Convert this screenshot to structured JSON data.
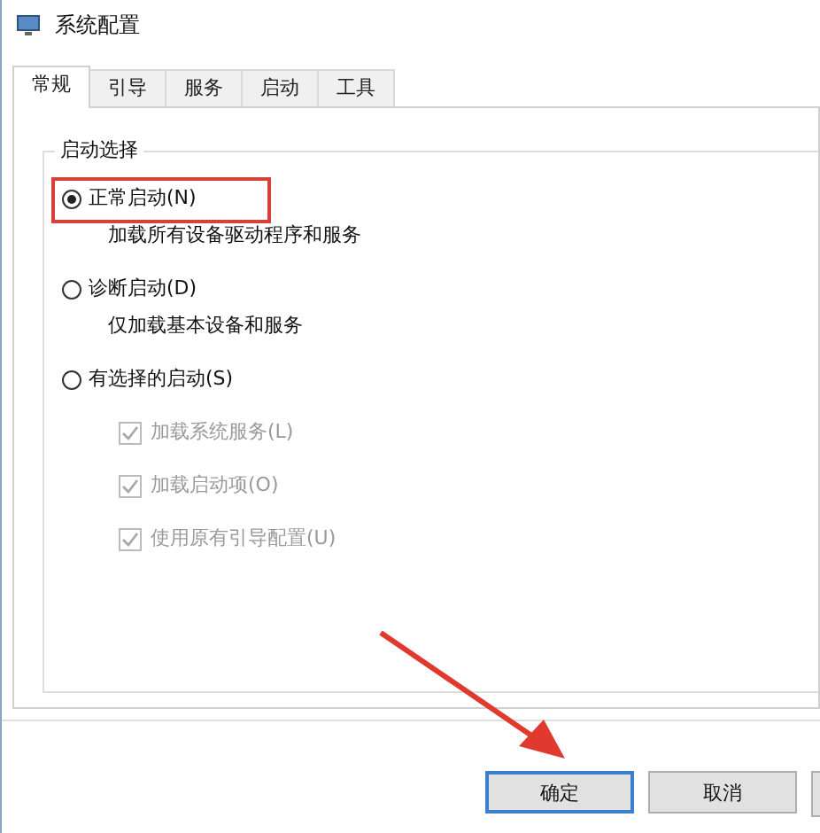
{
  "window": {
    "title": "系统配置"
  },
  "tabs": [
    {
      "label": "常规",
      "selected": true
    },
    {
      "label": "引导",
      "selected": false
    },
    {
      "label": "服务",
      "selected": false
    },
    {
      "label": "启动",
      "selected": false
    },
    {
      "label": "工具",
      "selected": false
    }
  ],
  "group": {
    "label": "启动选择"
  },
  "options": [
    {
      "label": "正常启动(N)",
      "selected": true,
      "description": "加载所有设备驱动程序和服务"
    },
    {
      "label": "诊断启动(D)",
      "selected": false,
      "description": "仅加载基本设备和服务"
    },
    {
      "label": "有选择的启动(S)",
      "selected": false,
      "children": [
        {
          "label": "加载系统服务(L)",
          "checked": true,
          "disabled": true
        },
        {
          "label": "加载启动项(O)",
          "checked": true,
          "disabled": true
        },
        {
          "label": "使用原有引导配置(U)",
          "checked": true,
          "disabled": true
        }
      ]
    }
  ],
  "buttons": [
    {
      "label": "确定",
      "selected": true
    },
    {
      "label": "取消",
      "selected": false
    }
  ]
}
